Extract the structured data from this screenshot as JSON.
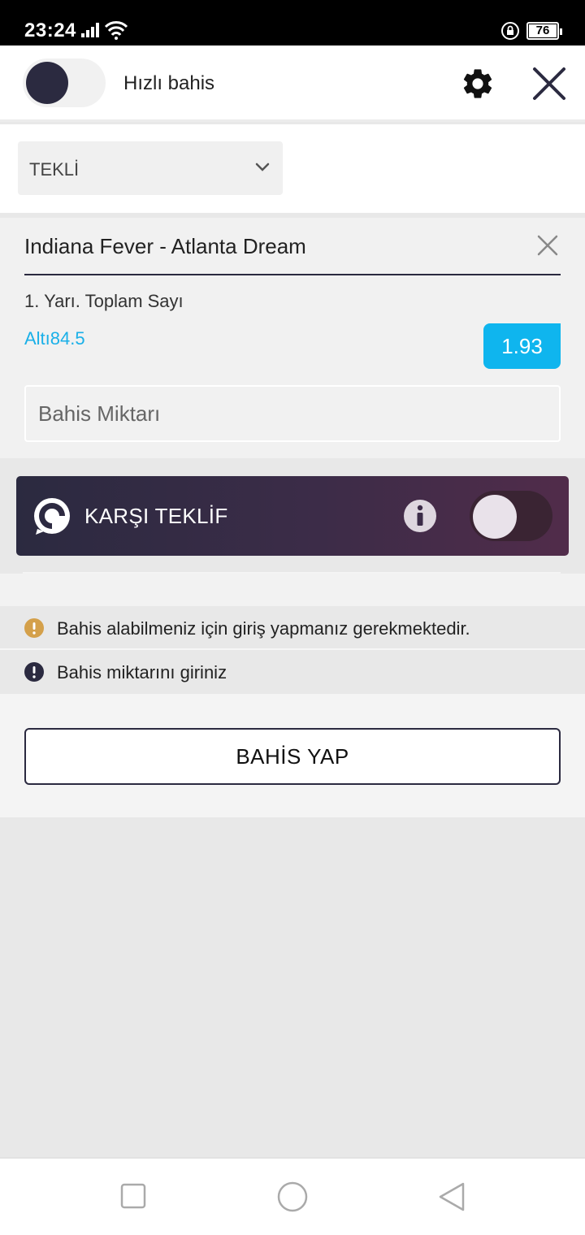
{
  "status": {
    "time": "23:24",
    "battery": "76"
  },
  "header": {
    "quick_bet_label": "Hızlı bahis"
  },
  "bet_type": {
    "selected": "TEKLİ"
  },
  "bet": {
    "match": "Indiana Fever - Atlanta Dream",
    "market": "1. Yarı. Toplam Sayı",
    "selection": "Altı84.5",
    "odds": "1.93",
    "stake_placeholder": "Bahis Miktarı"
  },
  "counter_offer": {
    "title": "KARŞI TEKLİF"
  },
  "messages": {
    "login_required": "Bahis alabilmeniz için giriş yapmanız gerekmektedir.",
    "enter_amount": "Bahis miktarını giriniz"
  },
  "actions": {
    "place_bet": "BAHİS YAP"
  },
  "colors": {
    "accent": "#0fb5ee",
    "dark": "#2b2a40",
    "warning": "#d4a04a"
  }
}
